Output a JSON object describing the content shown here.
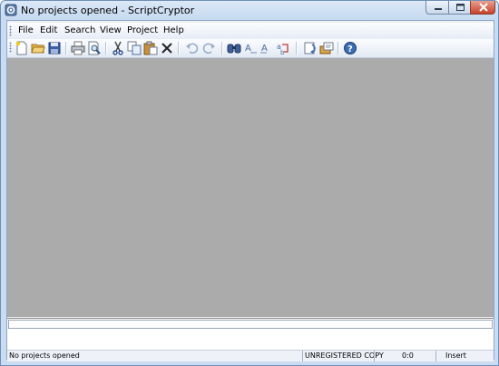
{
  "window": {
    "title": "No projects opened - ScriptCryptor"
  },
  "menu": {
    "items": [
      "File",
      "Edit",
      "Search",
      "View",
      "Project",
      "Help"
    ]
  },
  "toolbar": {
    "buttons": [
      "new-file-icon",
      "open-folder-icon",
      "save-icon",
      "print-icon",
      "print-preview-icon",
      "cut-icon",
      "copy-icon",
      "paste-icon",
      "delete-icon",
      "undo-icon",
      "redo-icon",
      "find-icon",
      "find-next-icon",
      "find-previous-icon",
      "replace-icon",
      "build-icon",
      "project-settings-icon",
      "help-icon"
    ]
  },
  "status": {
    "left": "No projects opened",
    "registration": "UNREGISTERED COPY",
    "position": "0:0",
    "mode": "Insert"
  },
  "colors": {
    "workspace": "#ababab",
    "frame": "#c9dcf1",
    "accent": "#3b6db3"
  }
}
